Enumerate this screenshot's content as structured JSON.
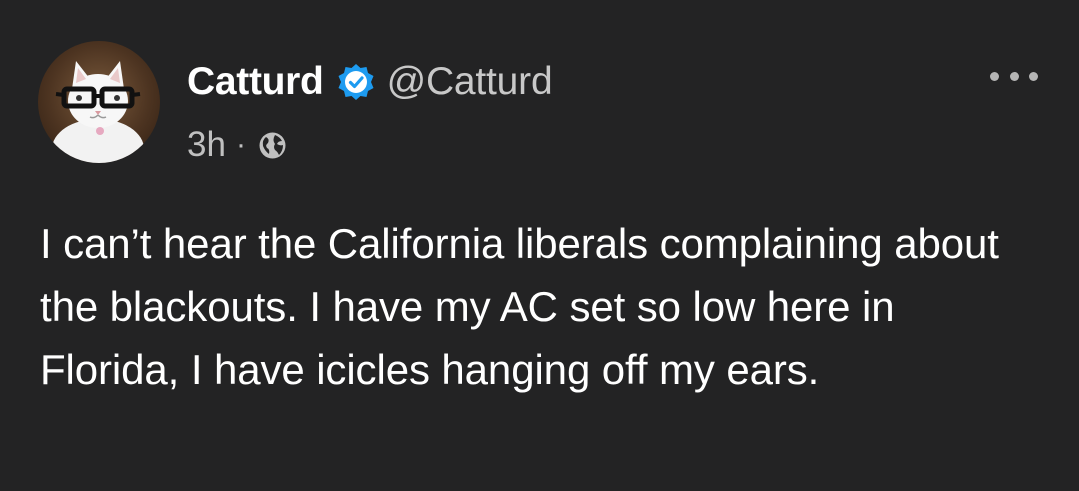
{
  "post": {
    "author": {
      "display_name": "Catturd",
      "handle": "@Catturd",
      "verified": true,
      "avatar_icon": "cat-with-glasses-avatar"
    },
    "meta": {
      "time": "3h",
      "separator": "·",
      "visibility_icon": "globe-icon"
    },
    "menu_icon": "more-options-icon",
    "text": "I can’t hear the California liberals complaining about the blackouts. I have my AC set so low here in Florida, I have icicles hanging off my ears."
  },
  "colors": {
    "background": "#232324",
    "text": "#ffffff",
    "secondary_text": "#c8c8c8",
    "verified_badge": "#1d9bf0"
  }
}
